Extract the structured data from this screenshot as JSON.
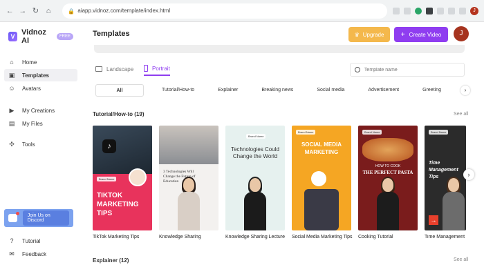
{
  "browser": {
    "url": "aiapp.vidnoz.com/template/index.html",
    "profile_initial": "J"
  },
  "sidebar": {
    "brand": "Vidnoz AI",
    "badge": "FREE",
    "items": [
      {
        "label": "Home",
        "icon": "home-icon"
      },
      {
        "label": "Templates",
        "icon": "templates-icon",
        "active": true
      },
      {
        "label": "Avatars",
        "icon": "avatar-icon"
      },
      {
        "label": "My Creations",
        "icon": "play-icon"
      },
      {
        "label": "My Files",
        "icon": "folder-icon"
      },
      {
        "label": "Tools",
        "icon": "tools-icon"
      }
    ],
    "discord_label": "Join Us on Discord",
    "bottom_items": [
      {
        "label": "Tutorial",
        "icon": "help-icon"
      },
      {
        "label": "Feedback",
        "icon": "mail-icon"
      }
    ]
  },
  "header": {
    "title": "Templates",
    "upgrade_label": "Upgrade",
    "create_label": "Create Video",
    "avatar_initial": "J"
  },
  "orientation": {
    "landscape": "Landscape",
    "portrait": "Portrait",
    "active": "Portrait"
  },
  "search": {
    "placeholder": "Template name"
  },
  "categories": [
    "All",
    "Tutorial/How-to",
    "Explainer",
    "Breaking news",
    "Social media",
    "Advertisement",
    "Greeting"
  ],
  "sections": [
    {
      "title": "Tutorial/How-to (19)",
      "see_all": "See all"
    },
    {
      "title": "Explainer (12)",
      "see_all": "See all"
    }
  ],
  "cards": [
    {
      "label": "TikTok Marketing Tips",
      "headline": "TIKTOK MARKETING TIPS",
      "brand": "Brand Name"
    },
    {
      "label": "Knowledge Sharing",
      "headline": "3 Technologies Will Change the Future of Education"
    },
    {
      "label": "Knowledge Sharing Lecture",
      "headline": "Technologies Could Change the World",
      "brand": "Brand Name"
    },
    {
      "label": "Social Media Marketing Tips",
      "headline": "SOCIAL MEDIA MARKETING",
      "brand": "Brand Name"
    },
    {
      "label": "Cooking Tutorial",
      "headline_small": "HOW TO COOK",
      "headline": "THE PERFECT PASTA",
      "brand": "Brand Name"
    },
    {
      "label": "Time Management Tips",
      "headline": "Time Management Tips",
      "brand": "Brand Name"
    }
  ],
  "colors": {
    "accent": "#8f3df0",
    "upgrade": "#f4b84c",
    "avatar": "#a6341f"
  }
}
